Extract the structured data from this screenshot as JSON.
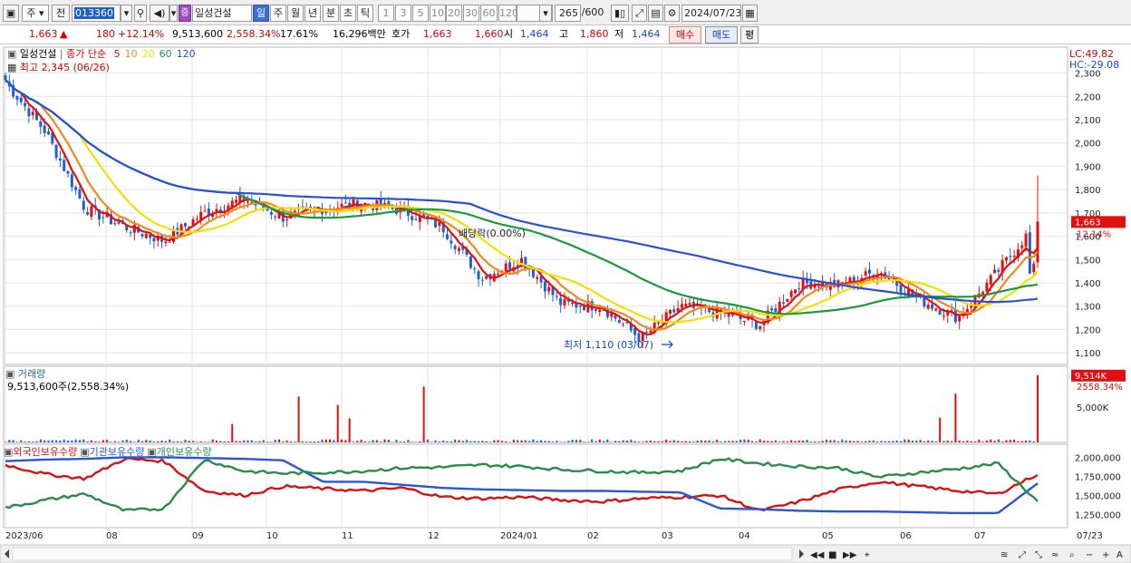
{
  "toolbar": {
    "market": "주",
    "prev_label": "전",
    "code": "013360",
    "stock_badge": "증",
    "stock_name": "일성건설",
    "periods": [
      "일",
      "주",
      "월",
      "년",
      "분",
      "초",
      "틱"
    ],
    "active_period": "일",
    "intervals": [
      "1",
      "3",
      "5",
      "10",
      "20",
      "30",
      "60",
      "120"
    ],
    "count": "265",
    "count_max": "/600",
    "date": "2024/07/23"
  },
  "infobar": {
    "price": "1,663",
    "change": "180",
    "change_pct": "+12.14%",
    "volume": "9,513,600",
    "volume_pct": "2,558.34%",
    "turnover": "17.61%",
    "amount": "16,296백만",
    "quote_label": "호가",
    "ask": "1,663",
    "bid": "1,660",
    "open_label": "시",
    "open": "1,464",
    "high_label": "고",
    "high": "1,860",
    "low_label": "저",
    "low": "1,464",
    "buy_label": "매수",
    "sell_label": "매도",
    "avg_label": "평"
  },
  "price_panel": {
    "legend_name": "일성건설",
    "legend_ma_label": "종가 단순",
    "ma_periods": [
      "5",
      "10",
      "20",
      "60",
      "120"
    ],
    "ma_colors": [
      "#e01010",
      "#f08a1a",
      "#f4e000",
      "#1a9a3a",
      "#2850d8"
    ],
    "max_label": "최고 2,345 (06/26)",
    "min_label": "최저 1,110 (03/07)",
    "dividend_label": "배당락(0.00%)",
    "lc_label": "LC:49.82",
    "hc_label": "HC:-29.08",
    "last_price_label": "1,663",
    "last_change_label": "12.14%",
    "y_ticks": [
      "2,300",
      "2,200",
      "2,100",
      "2,000",
      "1,900",
      "1,800",
      "1,700",
      "1,600",
      "1,500",
      "1,400",
      "1,300",
      "1,200",
      "1,100"
    ]
  },
  "volume_panel": {
    "title": "거래량",
    "value_label": "9,513,600주(2,558.34%)",
    "last_label": "9,514K",
    "last_pct_label": "2558.34%",
    "y_tick": "5,000K"
  },
  "holdings_panel": {
    "legend": [
      "외국인보유수량",
      "기관보유수량",
      "개인보유수량"
    ],
    "colors": [
      "#d81010",
      "#2a55d8",
      "#2a8a4a"
    ],
    "y_ticks": [
      "2,000,000",
      "1,750,000",
      "1,500,000",
      "1,250,000"
    ]
  },
  "x_axis": {
    "labels": [
      "2023/06",
      "08",
      "09",
      "10",
      "11",
      "12",
      "2024/01",
      "02",
      "03",
      "04",
      "05",
      "06",
      "07"
    ],
    "end_label": "07/23"
  },
  "chart_data": {
    "type": "line",
    "price_y_range": [
      1050,
      2380
    ],
    "anchors": [
      {
        "x": "2023/06",
        "close": 2260
      },
      {
        "x": "2023/07",
        "close": 2050
      },
      {
        "x": "2023/07",
        "close": 1720
      },
      {
        "x": "2023/08",
        "close": 1640
      },
      {
        "x": "2023/08",
        "close": 1580
      },
      {
        "x": "2023/09",
        "close": 1700
      },
      {
        "x": "2023/09",
        "close": 1760
      },
      {
        "x": "2023/10",
        "close": 1680
      },
      {
        "x": "2023/10",
        "close": 1720
      },
      {
        "x": "2023/11",
        "close": 1740
      },
      {
        "x": "2023/12",
        "close": 1710
      },
      {
        "x": "2023/12",
        "close": 1640
      },
      {
        "x": "2024/01",
        "close": 1420
      },
      {
        "x": "2024/01",
        "close": 1500
      },
      {
        "x": "2024/02",
        "close": 1310
      },
      {
        "x": "2024/02",
        "close": 1300
      },
      {
        "x": "2024/03",
        "close": 1160
      },
      {
        "x": "2024/03",
        "close": 1300
      },
      {
        "x": "2024/04",
        "close": 1270
      },
      {
        "x": "2024/04",
        "close": 1220
      },
      {
        "x": "2024/05",
        "close": 1400
      },
      {
        "x": "2024/05",
        "close": 1390
      },
      {
        "x": "2024/06",
        "close": 1450
      },
      {
        "x": "2024/06",
        "close": 1330
      },
      {
        "x": "2024/07",
        "close": 1250
      },
      {
        "x": "2024/07",
        "close": 1450
      },
      {
        "x": "2024/07/23",
        "close": 1663
      }
    ],
    "holdings_y_range": [
      1150000,
      2100000
    ]
  }
}
